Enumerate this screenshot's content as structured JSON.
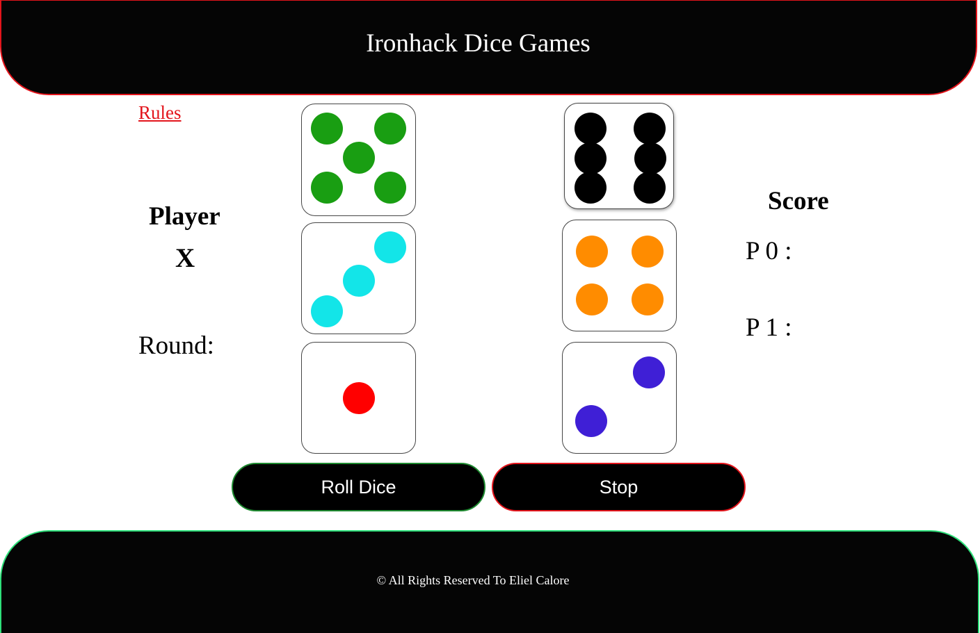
{
  "header": {
    "title": "Ironhack Dice Games"
  },
  "rules_link": "Rules",
  "player": {
    "label": "Player",
    "value": "X"
  },
  "round": {
    "label": "Round:"
  },
  "score": {
    "label": "Score",
    "p0": "P 0 :",
    "p1": "P 1 :"
  },
  "dice": [
    {
      "name": "die-left-top",
      "value": 5,
      "color": "#199e12"
    },
    {
      "name": "die-left-middle",
      "value": 3,
      "color": "#13e5e8"
    },
    {
      "name": "die-left-bottom",
      "value": 1,
      "color": "#ff0000"
    },
    {
      "name": "die-right-top",
      "value": 6,
      "color": "#000000"
    },
    {
      "name": "die-right-middle",
      "value": 4,
      "color": "#ff8c00"
    },
    {
      "name": "die-right-bottom",
      "value": 2,
      "color": "#3f1fd6"
    }
  ],
  "buttons": {
    "roll": "Roll Dice",
    "stop": "Stop"
  },
  "footer": {
    "text": "© All Rights Reserved To Eliel Calore"
  },
  "colors": {
    "accent_red": "#e3141b",
    "accent_green": "#2ee07a",
    "roll_border": "#1e8a30"
  }
}
